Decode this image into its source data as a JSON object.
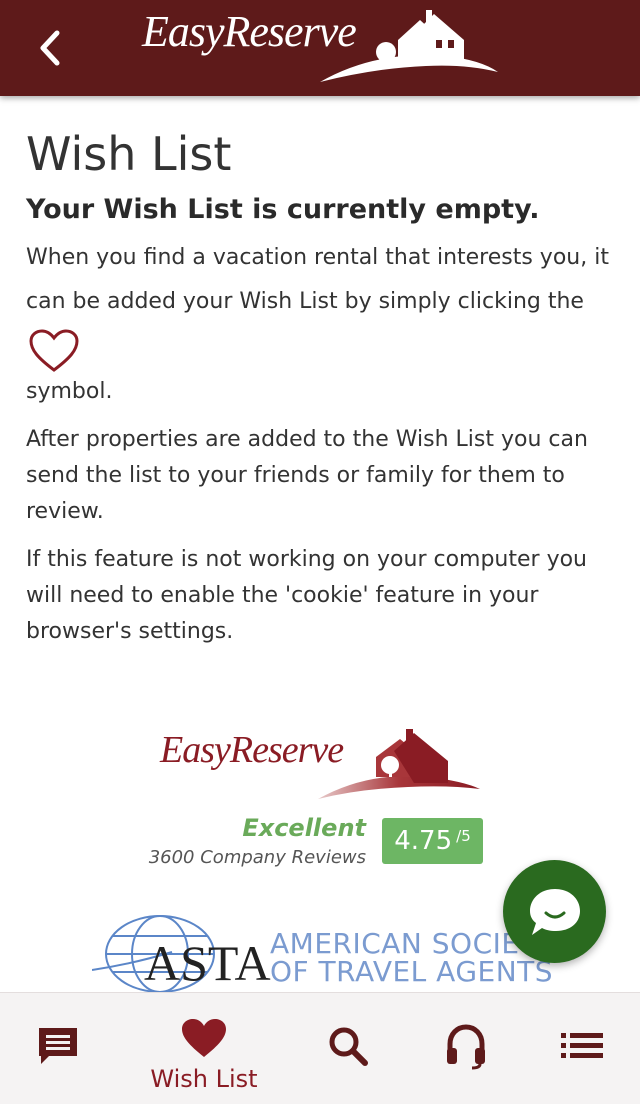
{
  "header": {
    "brand": "EasyReserve",
    "back_icon": "chevron-left-icon",
    "background": "#5e1a1a"
  },
  "main": {
    "title": "Wish List",
    "subtitle": "Your Wish List is currently empty.",
    "para1_line1": "When you find a vacation rental that interests you, it",
    "para1_line2": "can be added your Wish List by simply clicking the",
    "para1_line3": "symbol.",
    "para2": "After properties are added to the Wish List you can send the list to your friends or family for them to review.",
    "para3": "If this feature is not working on your computer you will need to enable the 'cookie' feature in your browser's settings.",
    "heart_icon": "heart-outline-icon"
  },
  "footer": {
    "brand": "EasyReserve",
    "rating_label": "Excellent",
    "reviews": "3600 Company Reviews",
    "score": "4.75",
    "score_max": "/5",
    "asta_abbrev": "ASTA",
    "asta_line1": "AMERICAN SOCIETY",
    "asta_line2": "OF TRAVEL AGENTS"
  },
  "chat_button": {
    "icon": "chat-bubble-icon",
    "color": "#2a6a1f"
  },
  "bottom_nav": {
    "items": [
      {
        "icon": "message-icon",
        "label": ""
      },
      {
        "icon": "heart-icon",
        "label": "Wish List"
      },
      {
        "icon": "search-icon",
        "label": ""
      },
      {
        "icon": "headphones-icon",
        "label": ""
      },
      {
        "icon": "list-icon",
        "label": ""
      }
    ],
    "active_color": "#8a1c24"
  },
  "colors": {
    "brand": "#5e1a1a",
    "accent": "#8a1c24",
    "rating_green": "#6db664"
  }
}
